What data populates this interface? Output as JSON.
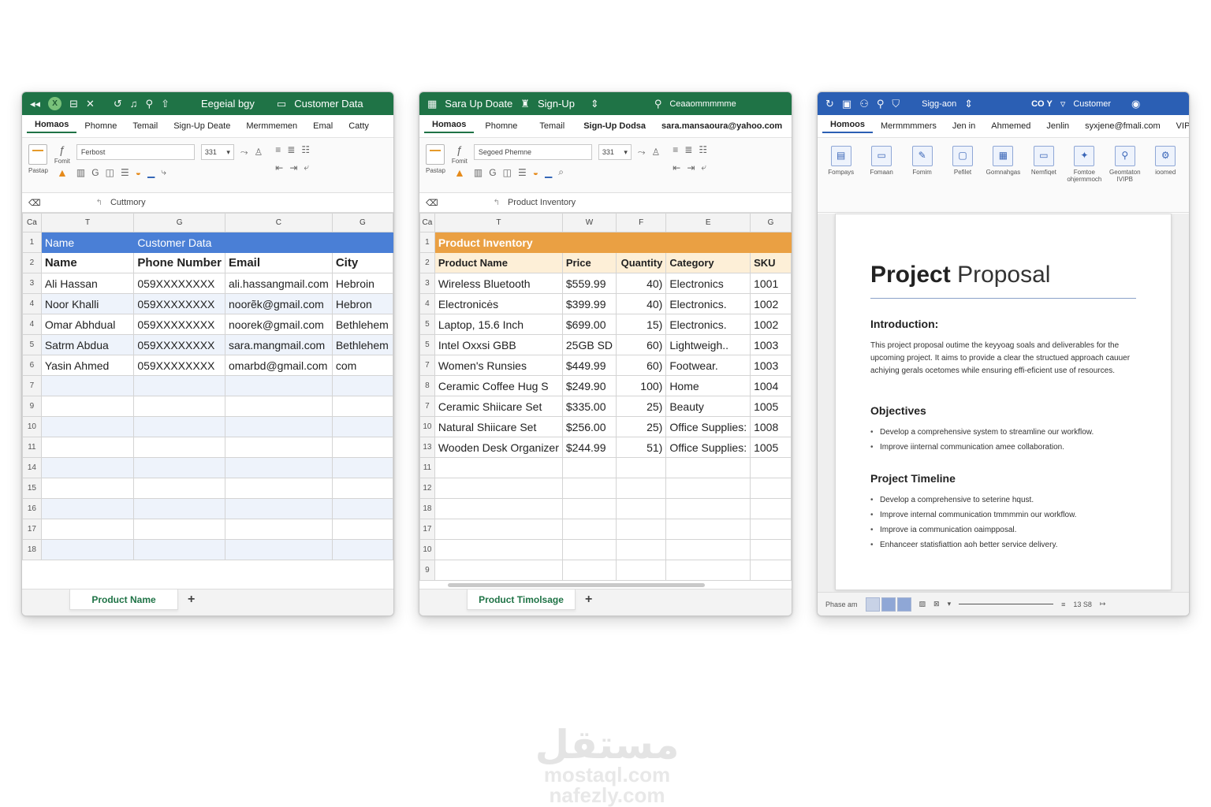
{
  "win1": {
    "title_center": "Eegeial bgy",
    "title_right": "Customer Data",
    "menu": [
      "Homaos",
      "Phomne",
      "Temail",
      "Sign-Up Deate",
      "Mermmemen",
      "Emal",
      "Catty"
    ],
    "font_name": "Ferbost",
    "font_size": "331",
    "paste_label": "Pastap",
    "format_label": "Fomit",
    "formula_text": "Cuttmory",
    "col_headers": [
      "Ca",
      "T",
      "G",
      "C",
      "G"
    ],
    "rows": [
      {
        "n": "1",
        "cells": [
          "Name",
          "Customer Data",
          "",
          ""
        ]
      },
      {
        "n": "2",
        "cells": [
          "Name",
          "Phone Number",
          "Email",
          "City"
        ]
      },
      {
        "n": "3",
        "cells": [
          "Ali Hassan",
          "059XXXXXXXX",
          "ali.hassangmail.com",
          "Hebroin"
        ]
      },
      {
        "n": "4",
        "cells": [
          "Noor Khalli",
          "059XXXXXXXX",
          "noorẽk@gmail.com",
          "Hebron"
        ]
      },
      {
        "n": "4",
        "cells": [
          "Omar Abhdual",
          "059XXXXXXXX",
          "noorek@gmail.com",
          "Bethlehem"
        ]
      },
      {
        "n": "5",
        "cells": [
          "Satrm Abdua",
          "059XXXXXXXX",
          "sara.mangmail.com",
          "Bethlehem"
        ]
      },
      {
        "n": "6",
        "cells": [
          "Yasin Ahmed",
          "059XXXXXXXX",
          "omarbd@gmail.com",
          "com"
        ]
      },
      {
        "n": "7",
        "cells": [
          "",
          "",
          "",
          ""
        ]
      },
      {
        "n": "9",
        "cells": [
          "",
          "",
          "",
          ""
        ]
      },
      {
        "n": "10",
        "cells": [
          "",
          "",
          "",
          ""
        ]
      },
      {
        "n": "11",
        "cells": [
          "",
          "",
          "",
          ""
        ]
      },
      {
        "n": "14",
        "cells": [
          "",
          "",
          "",
          ""
        ]
      },
      {
        "n": "15",
        "cells": [
          "",
          "",
          "",
          ""
        ]
      },
      {
        "n": "16",
        "cells": [
          "",
          "",
          "",
          ""
        ]
      },
      {
        "n": "17",
        "cells": [
          "",
          "",
          "",
          ""
        ]
      },
      {
        "n": "18",
        "cells": [
          "",
          "",
          "",
          ""
        ]
      }
    ],
    "sheet_tab": "Product Name",
    "add_tab": "+"
  },
  "win2": {
    "title_left": "Sara Up Doate",
    "title_center": "Sign-Up",
    "title_right": "Ceaaommmmme",
    "menu": [
      "Homaos",
      "Phomne",
      "Temail",
      "Sign-Up Dodsa",
      "sara.mansaoura@yahoo.com"
    ],
    "font_name": "Segoed Phemne",
    "font_size": "331",
    "paste_label": "Pastap",
    "format_label": "Fomit",
    "formula_text": "Product Inventory",
    "col_headers": [
      "Ca",
      "T",
      "W",
      "F",
      "E",
      "G"
    ],
    "rows": [
      {
        "n": "1",
        "cells": [
          "Product Inventory",
          "",
          "",
          "",
          ""
        ]
      },
      {
        "n": "2",
        "cells": [
          "Product Name",
          "Price",
          "Quantity",
          "Category",
          "SKU"
        ]
      },
      {
        "n": "3",
        "cells": [
          "Wireless Bluetooth",
          "$559.99",
          "40)",
          "Electronics",
          "1001"
        ]
      },
      {
        "n": "4",
        "cells": [
          "Electronicės",
          "$399.99",
          "40)",
          "Electronics.",
          "1002"
        ]
      },
      {
        "n": "5",
        "cells": [
          "Laptop, 15.6 Inch",
          "$699.00",
          "15)",
          "Electronics.",
          "1002"
        ]
      },
      {
        "n": "5",
        "cells": [
          "Intel Oxxsi GBB",
          "25GB SD",
          "60)",
          "Lightweigh..",
          "1003"
        ]
      },
      {
        "n": "7",
        "cells": [
          "Women's Runsies",
          "$449.99",
          "60)",
          "Footwear.",
          "1003"
        ]
      },
      {
        "n": "8",
        "cells": [
          "Ceramic Coffee Hug S",
          "$249.90",
          "100)",
          "Home",
          "1004"
        ]
      },
      {
        "n": "7",
        "cells": [
          "Ceramic Shiicare Set",
          "$335.00",
          "25)",
          "Beauty",
          "1005"
        ]
      },
      {
        "n": "10",
        "cells": [
          "Natural Shiicare Set",
          "$256.00",
          "25)",
          "Office Supplies:",
          "1008"
        ]
      },
      {
        "n": "13",
        "cells": [
          "Wooden Desk Organizer",
          "$244.99",
          "51)",
          "Office Supplies:",
          "1005"
        ]
      },
      {
        "n": "11",
        "cells": [
          "",
          "",
          "",
          "",
          ""
        ]
      },
      {
        "n": "12",
        "cells": [
          "",
          "",
          "",
          "",
          ""
        ]
      },
      {
        "n": "18",
        "cells": [
          "",
          "",
          "",
          "",
          ""
        ]
      },
      {
        "n": "17",
        "cells": [
          "",
          "",
          "",
          "",
          ""
        ]
      },
      {
        "n": "10",
        "cells": [
          "",
          "",
          "",
          "",
          ""
        ]
      },
      {
        "n": "9",
        "cells": [
          "",
          "",
          "",
          "",
          ""
        ]
      }
    ],
    "sheet_tab": "Product Timolsage",
    "add_tab": "+"
  },
  "win3": {
    "title_center": "Sigg-aon",
    "title_right_a": "CO Y",
    "title_right_b": "Customer",
    "menu": [
      "Homoos",
      "Mermmmmers",
      "Jen in",
      "Ahmemed",
      "Jenlin",
      "syxjene@fmali.com",
      "VIPı"
    ],
    "ribbon": [
      {
        "label": "Fompays",
        "icon": "▤"
      },
      {
        "label": "Fomaan",
        "icon": "▭"
      },
      {
        "label": "Fomim",
        "icon": "✎"
      },
      {
        "label": "Pefilet",
        "icon": "▢"
      },
      {
        "label": "Gomnahgas",
        "icon": "▦"
      },
      {
        "label": "Nemfiqet",
        "icon": "▭"
      },
      {
        "label": "Fomtoe ohjermmoch",
        "icon": "✦"
      },
      {
        "label": "Geomtaton IVIPB",
        "icon": "⚲"
      },
      {
        "label": "ioomed",
        "icon": "⚙"
      }
    ],
    "doc": {
      "title_bold": "Project",
      "title_light": "Proposal",
      "h_intro": "Introduction:",
      "intro": "This project proposal outime the keyyoag soals and deliverables for the upcoming project. It aims to provide a clear the structued approach cauuer achiying gerals ocetomes while ensuring effi-eficient use of resources.",
      "h_obj": "Objectives",
      "objectives": [
        "Develop a comprehensive system to streamline our workflow.",
        "Improve iinternal communication amee collaboration."
      ],
      "h_timeline": "Project Timeline",
      "timeline": [
        "Develop a comprehensive to seterine hqust.",
        "Improve internal communication tmmmmin our workflow.",
        "Improve ia communication oaimpposal.",
        "Enhanceer statisfiattion aoh better service delivery."
      ]
    },
    "status_left": "Phase am",
    "status_zoom": "13 S8"
  },
  "watermark": {
    "arabic": "مستقل",
    "line1": "mostaql.com",
    "line2": "nafezly.com"
  },
  "colors": {
    "excel_green": "#1f7346",
    "word_blue": "#2b5fb4",
    "header_blue": "#4a7fd6",
    "header_orange": "#eaa043"
  }
}
